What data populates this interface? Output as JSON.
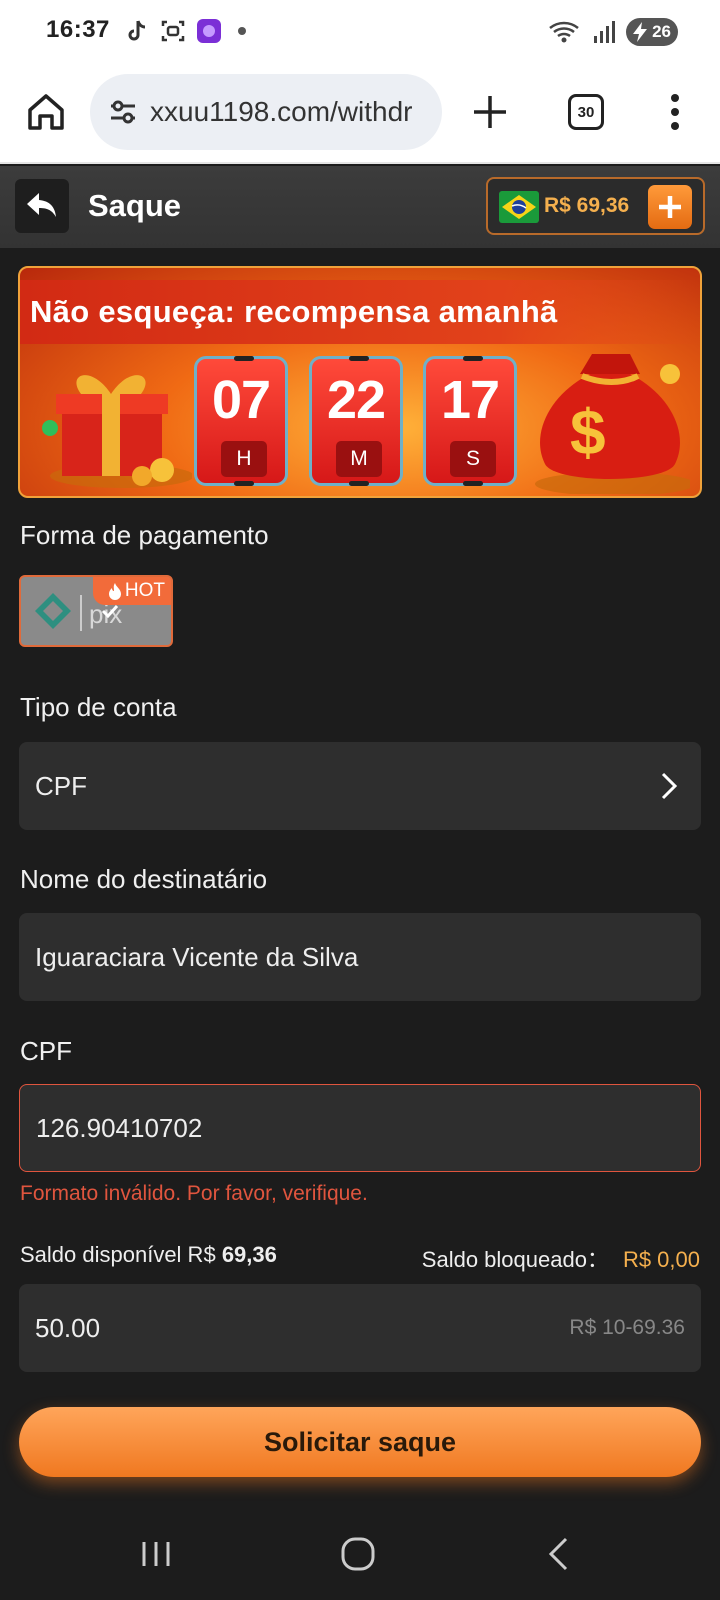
{
  "status_bar": {
    "time": "16:37",
    "battery": "26"
  },
  "browser": {
    "url": "xxuu1198.com/withdr",
    "tab_count": "30"
  },
  "header": {
    "title": "Saque",
    "balance": "R$ 69,36"
  },
  "banner": {
    "title": "Não esqueça: recompensa amanhã",
    "timer": [
      {
        "value": "07",
        "unit": "H"
      },
      {
        "value": "22",
        "unit": "M"
      },
      {
        "value": "17",
        "unit": "S"
      }
    ]
  },
  "payment": {
    "label": "Forma de pagamento",
    "method": "pix",
    "badge": "HOT"
  },
  "account_type": {
    "label": "Tipo de conta",
    "value": "CPF"
  },
  "recipient": {
    "label": "Nome do destinatário",
    "value": "Iguaraciara Vicente da Silva"
  },
  "cpf": {
    "label": "CPF",
    "value": "126.90410702",
    "error": "Formato inválido. Por favor, verifique."
  },
  "balance_info": {
    "available_label": "Saldo disponível R$",
    "available_value": "69,36",
    "blocked_label": "Saldo bloqueado：",
    "blocked_value": "R$ 0,00"
  },
  "amount": {
    "value": "50.00",
    "range_hint": "R$ 10-69.36"
  },
  "submit_label": "Solicitar saque",
  "colors": {
    "accent": "#f07820",
    "error": "#e0553e",
    "gold": "#f5b04e",
    "background": "#1c1c1c"
  }
}
